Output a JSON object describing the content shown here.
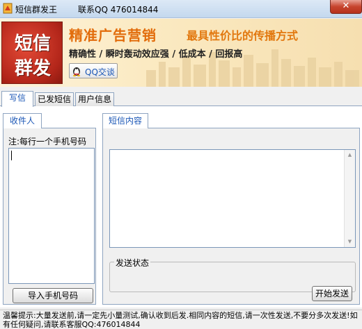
{
  "window": {
    "title": "短信群发王",
    "contact": "联系QQ 476014844",
    "close_label": "✕"
  },
  "banner": {
    "logo_line1": "短信",
    "logo_line2": "群发",
    "slogan_main": "精准广告营销",
    "slogan_sub": "最具性价比的传播方式",
    "points": "精确性 / 瞬时轰动效应强 / 低成本 / 回报高",
    "qq_button": "QQ交谈"
  },
  "tabs": [
    {
      "label": "写信",
      "active": true
    },
    {
      "label": "已发短信",
      "active": false
    },
    {
      "label": "用户信息",
      "active": false
    }
  ],
  "recipients": {
    "group_title": "收件人",
    "note": "注:每行一个手机号码",
    "value": "",
    "import_button": "导入手机号码"
  },
  "sms": {
    "group_title": "短信内容",
    "value": "",
    "status_label": "发送状态",
    "send_button": "开始发送"
  },
  "footer": {
    "tip": "温馨提示:大量发送前,请一定先小量测试,确认收到后发.相同内容的短信,请一次性发送,不要分多次发送!如有任何疑问,请联系客服QQ:476014844"
  },
  "colors": {
    "accent_orange": "#e26c0b",
    "tab_blue": "#1a56b6",
    "logo_red": "#b3261a",
    "close_red": "#c7442e"
  }
}
